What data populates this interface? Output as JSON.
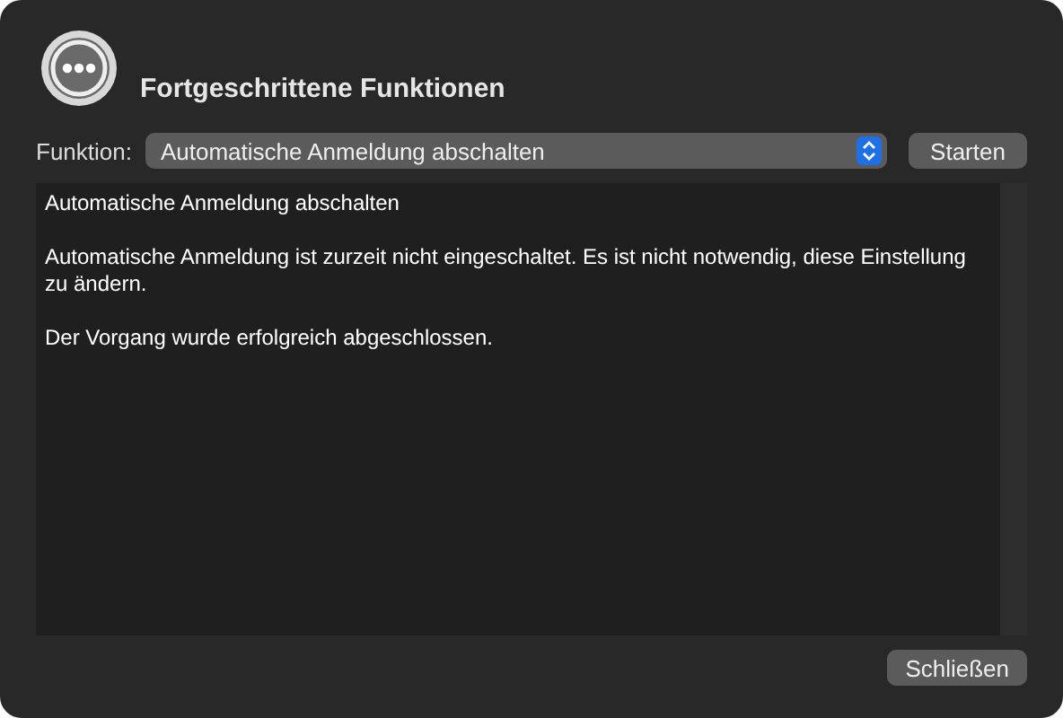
{
  "window": {
    "title": "Fortgeschrittene Funktionen"
  },
  "function_row": {
    "label": "Funktion:",
    "value": "Automatische Anmeldung abschalten",
    "button": "Starten"
  },
  "log": [
    "Automatische Anmeldung abschalten",
    "Automatische Anmeldung ist zurzeit nicht eingeschaltet. Es ist nicht notwendig, diese Einstellung zu ändern.",
    "Der Vorgang wurde erfolgreich abgeschlossen."
  ],
  "buttons": [
    "Schließen"
  ]
}
